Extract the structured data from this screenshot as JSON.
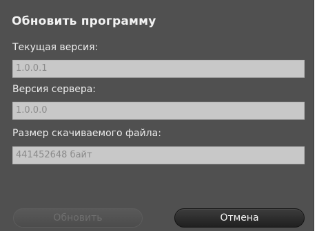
{
  "dialog": {
    "title": "Обновить программу",
    "fields": [
      {
        "label": "Текущая версия:",
        "value": "1.0.0.1"
      },
      {
        "label": "Версия сервера:",
        "value": "1.0.0.0"
      },
      {
        "label": "Размер скачиваемого файла:",
        "value": "441452648 байт"
      }
    ],
    "buttons": {
      "update_label": "Обновить",
      "update_enabled": false,
      "cancel_label": "Отмена"
    },
    "colors": {
      "background": "#505050",
      "field_background": "#c8c8c8",
      "field_text": "#8a8a8a",
      "label_text": "#ececec"
    }
  }
}
